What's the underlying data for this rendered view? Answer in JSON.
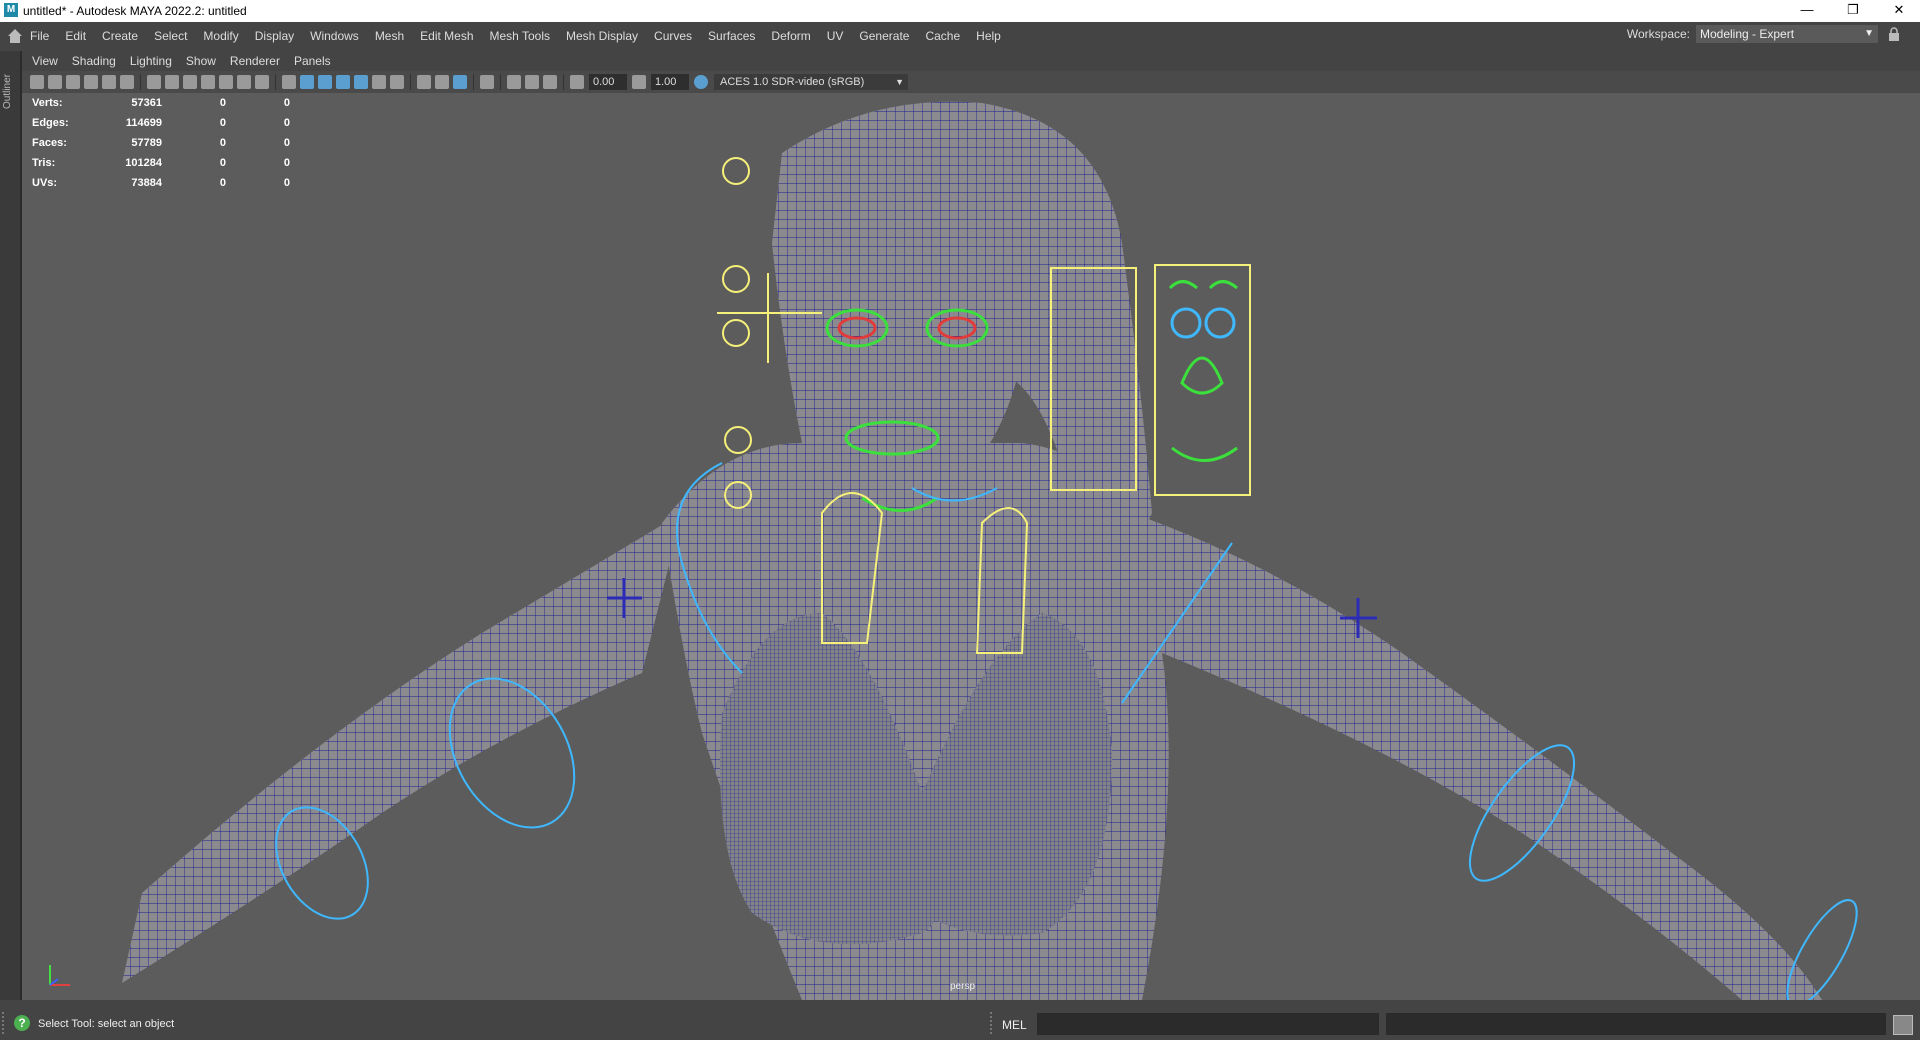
{
  "window": {
    "title": "untitled* - Autodesk MAYA 2022.2: untitled",
    "app_icon": "M",
    "controls": [
      "minimize-icon",
      "restore-icon",
      "close-icon"
    ]
  },
  "menubar": {
    "items": [
      "File",
      "Edit",
      "Create",
      "Select",
      "Modify",
      "Display",
      "Windows",
      "Mesh",
      "Edit Mesh",
      "Mesh Tools",
      "Mesh Display",
      "Curves",
      "Surfaces",
      "Deform",
      "UV",
      "Generate",
      "Cache",
      "Help"
    ],
    "workspace_label": "Workspace:",
    "workspace_value": "Modeling - Expert"
  },
  "side_panel": {
    "outliner_label": "Outliner"
  },
  "panel_menu": {
    "items": [
      "View",
      "Shading",
      "Lighting",
      "Show",
      "Renderer",
      "Panels"
    ]
  },
  "toolbar": {
    "exposure": "0.00",
    "gamma": "1.00",
    "color_space": "ACES 1.0 SDR-video (sRGB)"
  },
  "hud": {
    "rows": [
      {
        "label": "Verts:",
        "v1": "57361",
        "v2": "0",
        "v3": "0"
      },
      {
        "label": "Edges:",
        "v1": "114699",
        "v2": "0",
        "v3": "0"
      },
      {
        "label": "Faces:",
        "v1": "57789",
        "v2": "0",
        "v3": "0"
      },
      {
        "label": "Tris:",
        "v1": "101284",
        "v2": "0",
        "v3": "0"
      },
      {
        "label": "UVs:",
        "v1": "73884",
        "v2": "0",
        "v3": "0"
      }
    ]
  },
  "viewport": {
    "camera": "persp"
  },
  "statusbar": {
    "help_text": "Select Tool: select an object",
    "mel_label": "MEL"
  },
  "colors": {
    "viewport_bg": "#5c5c5c",
    "wireframe": "#1a1a8c",
    "control_yellow": "#f5f07a",
    "control_cyan": "#3fb8ff",
    "control_green": "#3ce03c"
  }
}
